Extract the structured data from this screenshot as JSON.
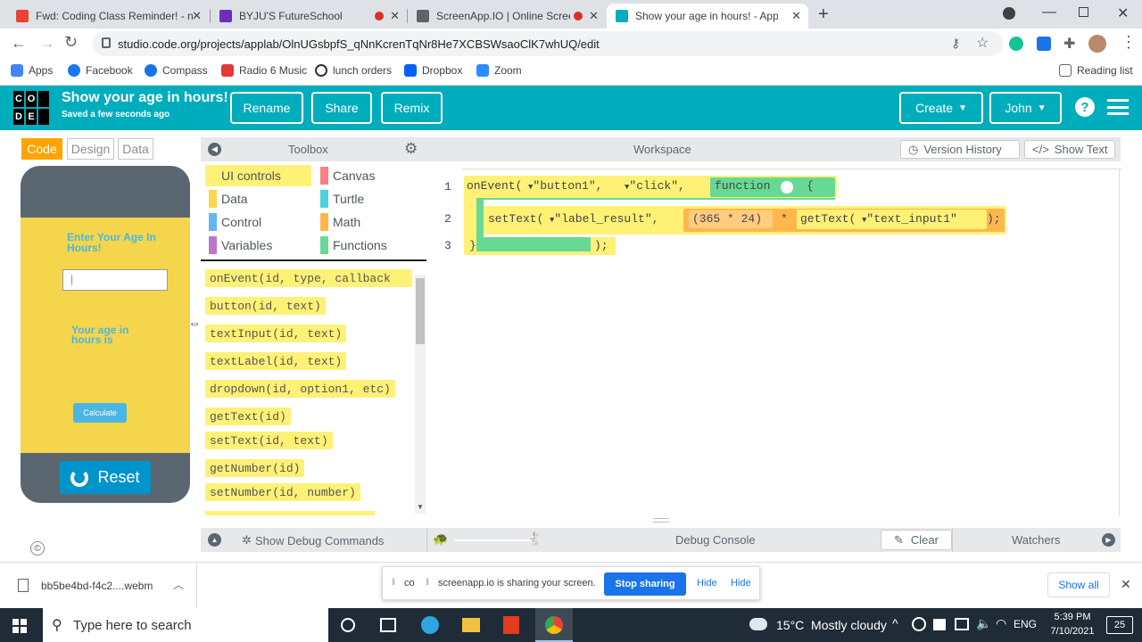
{
  "browser": {
    "tabs": [
      {
        "title": "Fwd: Coding Class Reminder! - n",
        "favicon_color": "#ea4335"
      },
      {
        "title": "BYJU'S FutureSchool",
        "favicon_color": "#6f2dbd"
      },
      {
        "title": "ScreenApp.IO | Online Screen",
        "favicon_color": "#5f6368"
      },
      {
        "title": "Show your age in hours! - App La",
        "favicon_color": "#00adbc"
      }
    ],
    "url": "studio.code.org/projects/applab/OlnUGsbpfS_qNnKcrenTqNr8He7XCBSWsaoClK7whUQ/edit",
    "bookmarks": [
      {
        "label": "Apps",
        "icon": "apps-grid-icon",
        "color": "#4285f4"
      },
      {
        "label": "Facebook",
        "icon": "facebook-icon",
        "color": "#1877f2"
      },
      {
        "label": "Compass",
        "icon": "compass-icon",
        "color": "#1a73e8"
      },
      {
        "label": "Radio 6 Music",
        "icon": "radio-icon",
        "color": "#e53935"
      },
      {
        "label": "lunch orders",
        "icon": "lunch-icon",
        "color": "#333333"
      },
      {
        "label": "Dropbox",
        "icon": "dropbox-icon",
        "color": "#0061ff"
      },
      {
        "label": "Zoom",
        "icon": "zoom-icon",
        "color": "#2d8cff"
      }
    ],
    "reading_list": "Reading list"
  },
  "header": {
    "logo_letters": [
      "C",
      "O",
      "D",
      "E"
    ],
    "project_title": "Show your age in hours!",
    "saved_status": "Saved a few seconds ago",
    "rename": "Rename",
    "share": "Share",
    "remix": "Remix",
    "create": "Create",
    "user": "John",
    "accent": "#00adbc"
  },
  "modes": {
    "code": "Code",
    "design": "Design",
    "data": "Data"
  },
  "app_preview": {
    "prompt": "Enter Your Age In Hours!",
    "input_value": "|",
    "result_label": "Your age in hours is",
    "calculate": "Calculate",
    "reset": "Reset"
  },
  "toolbox": {
    "title": "Toolbox",
    "categories": [
      {
        "label": "UI controls",
        "color": "#fff176"
      },
      {
        "label": "Canvas",
        "color": "#f78183"
      },
      {
        "label": "Data",
        "color": "#ffd54f"
      },
      {
        "label": "Turtle",
        "color": "#4dd0e1"
      },
      {
        "label": "Control",
        "color": "#64b5f6"
      },
      {
        "label": "Math",
        "color": "#ffb74d"
      },
      {
        "label": "Variables",
        "color": "#bb77c7"
      },
      {
        "label": "Functions",
        "color": "#68d995"
      }
    ],
    "blocks": [
      "onEvent(id, type, callback",
      "button(id, text)",
      "textInput(id, text)",
      "textLabel(id, text)",
      "dropdown(id, option1, etc)",
      "getText(id)",
      "setText(id, text)",
      "getNumber(id)",
      "setNumber(id, number)"
    ]
  },
  "workspace": {
    "title": "Workspace",
    "version_history": "Version History",
    "show_text": "Show Text",
    "line_numbers": [
      "1",
      "2",
      "3"
    ],
    "line1": {
      "fn": "onEvent(",
      "arg1": "\"button1\",",
      "arg2": "\"click\",",
      "func": "function",
      "brace": "{"
    },
    "line2": {
      "fn": "setText(",
      "arg1": "\"label_result\",",
      "expr": "(365 * 24)",
      "op": "*",
      "gettext": "getText(",
      "arg": "\"text_input1\"",
      "end": ");"
    },
    "line3": {
      "close": "}",
      "end": ");"
    }
  },
  "debug": {
    "show_debug": "Show Debug Commands",
    "console": "Debug Console",
    "clear": "Clear",
    "watchers": "Watchers"
  },
  "downloads": {
    "file": "bb5be4bd-f4c2....webm",
    "sharing_text": "screenapp.io is sharing your screen.",
    "stop": "Stop sharing",
    "hide": "Hide",
    "show_all": "Show all",
    "partial": "co"
  },
  "taskbar": {
    "search": "Type here to search",
    "weather": "15°C  Mostly cloudy",
    "lang": "ENG",
    "time": "5:39 PM",
    "date": "7/10/2021",
    "notif": "25"
  }
}
